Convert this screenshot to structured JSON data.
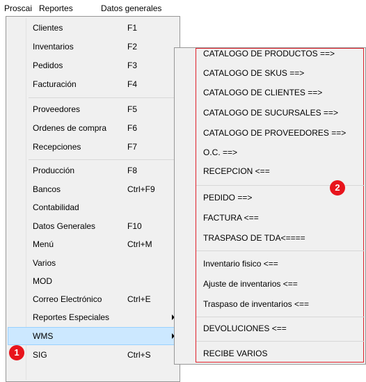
{
  "menubar": {
    "items": [
      "Proscai",
      "Reportes",
      "Datos generales"
    ]
  },
  "menu": {
    "items": [
      {
        "label": "Clientes",
        "shortcut": "F1"
      },
      {
        "label": "Inventarios",
        "shortcut": "F2"
      },
      {
        "label": "Pedidos",
        "shortcut": "F3"
      },
      {
        "label": "Facturación",
        "shortcut": "F4"
      },
      {
        "label": "Proveedores",
        "shortcut": "F5"
      },
      {
        "label": "Ordenes de compra",
        "shortcut": "F6"
      },
      {
        "label": "Recepciones",
        "shortcut": "F7"
      },
      {
        "label": "Producción",
        "shortcut": "F8"
      },
      {
        "label": "Bancos",
        "shortcut": "Ctrl+F9"
      },
      {
        "label": "Contabilidad",
        "shortcut": ""
      },
      {
        "label": "Datos Generales",
        "shortcut": "F10"
      },
      {
        "label": "Menú",
        "shortcut": "Ctrl+M"
      },
      {
        "label": "Varios",
        "shortcut": ""
      },
      {
        "label": "MOD",
        "shortcut": ""
      },
      {
        "label": "Correo Electrónico",
        "shortcut": "Ctrl+E"
      },
      {
        "label": "Reportes Especiales",
        "shortcut": ""
      },
      {
        "label": "WMS",
        "shortcut": ""
      },
      {
        "label": "SIG",
        "shortcut": "Ctrl+S"
      }
    ]
  },
  "submenu": {
    "items": [
      "CATALOGO DE PRODUCTOS ==>",
      "CATALOGO DE SKUS ==>",
      "CATALOGO DE CLIENTES  ==>",
      "CATALOGO DE SUCURSALES  ==>",
      "CATALOGO DE PROVEEDORES  ==>",
      "O.C. ==>",
      "RECEPCION <==",
      "PEDIDO ==>",
      "FACTURA <==",
      "TRASPASO DE TDA<====",
      "Inventario fisico <==",
      "Ajuste de inventarios <==",
      "Traspaso de inventarios <==",
      "DEVOLUCIONES <==",
      "RECIBE VARIOS"
    ]
  },
  "annotations": {
    "badge1": "1",
    "badge2": "2"
  },
  "colors": {
    "highlight": "#cce8ff",
    "annotation_red": "#e8141c"
  }
}
